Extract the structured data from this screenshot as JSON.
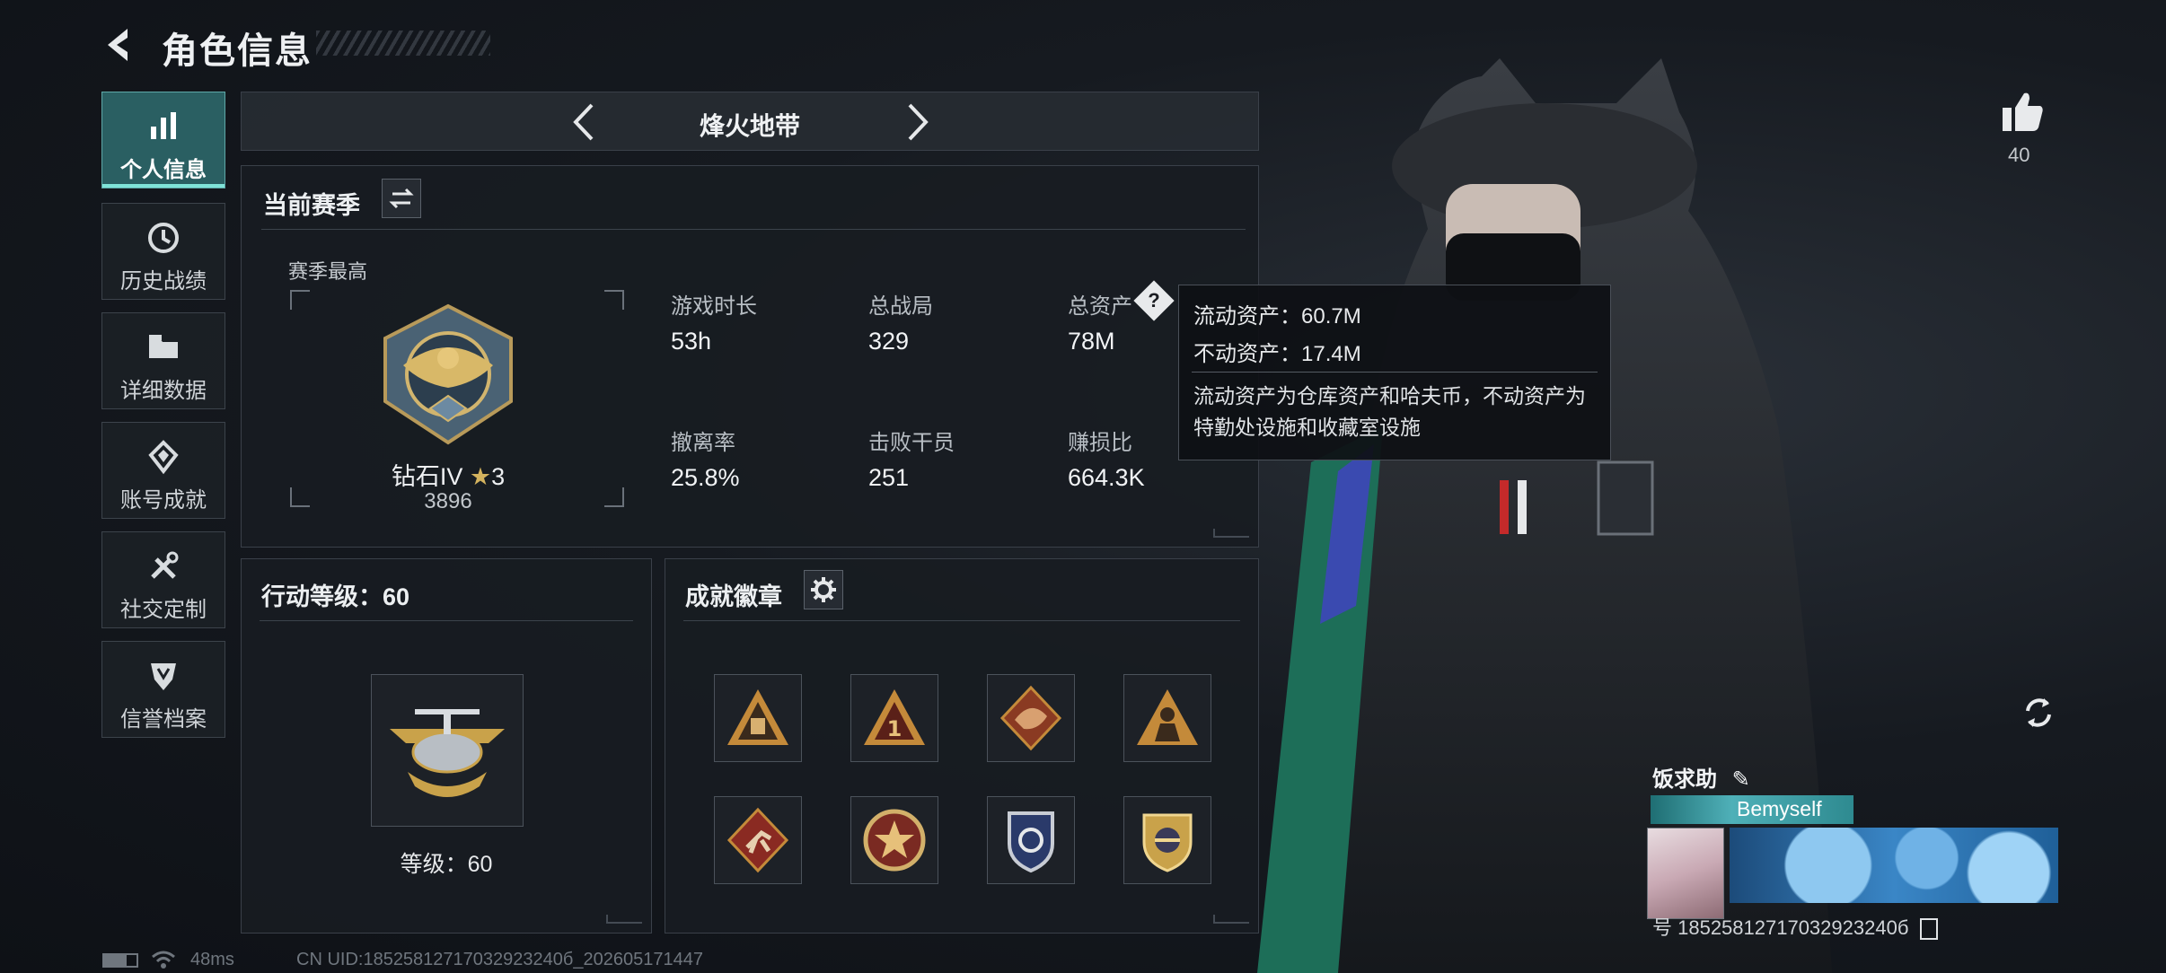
{
  "header": {
    "title": "角色信息"
  },
  "sidebar": {
    "items": [
      {
        "label": "个人信息",
        "icon": "bar-chart-icon",
        "active": true
      },
      {
        "label": "历史战绩",
        "icon": "history-icon"
      },
      {
        "label": "详细数据",
        "icon": "folder-icon"
      },
      {
        "label": "账号成就",
        "icon": "achievement-icon"
      },
      {
        "label": "社交定制",
        "icon": "tools-icon"
      },
      {
        "label": "信誉档案",
        "icon": "credit-shield-icon"
      }
    ]
  },
  "mode": {
    "title": "烽火地带"
  },
  "season": {
    "title": "当前赛季",
    "best_label": "赛季最高",
    "rank_name": "钻石IV",
    "rank_stars": "3",
    "rank_score": "3896",
    "stats": [
      {
        "label": "游戏时长",
        "value": "53h"
      },
      {
        "label": "总战局",
        "value": "329"
      },
      {
        "label": "总资产",
        "value": "78M"
      },
      {
        "label": "撤离率",
        "value": "25.8%"
      },
      {
        "label": "击败干员",
        "value": "251"
      },
      {
        "label": "赚损比",
        "value": "664.3K"
      }
    ]
  },
  "tooltip": {
    "liquid": "流动资产：60.7M",
    "fixed": "不动资产：17.4M",
    "desc": "流动资产为仓库资产和哈夫币，不动资产为特勤处设施和收藏室设施"
  },
  "action_level": {
    "title": "行动等级：60",
    "level_text": "等级：60"
  },
  "achievements": {
    "title": "成就徽章",
    "badges": [
      "supply-crate-badge",
      "number-one-badge",
      "dragon-badge",
      "soldier-badge",
      "runner-badge",
      "star-emblem-badge",
      "shield-emblem-badge",
      "gold-crest-badge"
    ]
  },
  "profile": {
    "likes": "40",
    "name": "饭求助",
    "plate_name": "Bemyself",
    "uid_line": "号 18525812717032923240б"
  },
  "footer": {
    "ping": "48ms",
    "uid": "CN UID:18525812717032923240б_202605171447"
  },
  "colors": {
    "accent_teal": "#2a5f62",
    "accent_light": "#7fe3d8",
    "panel_bg": "#181c22",
    "gold": "#c9a24a"
  }
}
